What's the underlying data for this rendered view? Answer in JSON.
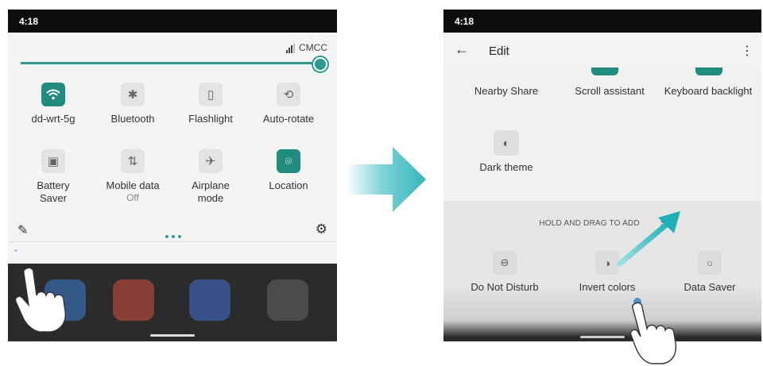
{
  "left_screen": {
    "status_time": "4:18",
    "carrier": "CMCC",
    "tiles": [
      {
        "label": "dd-wrt-5g",
        "sub": "",
        "icon": "wifi-icon",
        "active": true
      },
      {
        "label": "Bluetooth",
        "sub": "",
        "icon": "bluetooth-icon",
        "active": false
      },
      {
        "label": "Flashlight",
        "sub": "",
        "icon": "flashlight-icon",
        "active": false
      },
      {
        "label": "Auto-rotate",
        "sub": "",
        "icon": "auto-rotate-icon",
        "active": false
      },
      {
        "label": "Battery\nSaver",
        "sub": "",
        "icon": "battery-saver-icon",
        "active": false
      },
      {
        "label": "Mobile data",
        "sub": "Off",
        "icon": "mobile-data-icon",
        "active": false
      },
      {
        "label": "Airplane\nmode",
        "sub": "",
        "icon": "airplane-icon",
        "active": false
      },
      {
        "label": "Location",
        "sub": "",
        "icon": "location-icon",
        "active": true
      }
    ]
  },
  "right_screen": {
    "status_time": "4:18",
    "title": "Edit",
    "edit_tiles": [
      "Nearby Share",
      "Scroll assistant",
      "Keyboard backlight",
      "Dark theme"
    ],
    "hold_hint": "HOLD AND DRAG TO ADD",
    "hold_tail": "S",
    "hold_tiles": [
      "Do Not Disturb",
      "Invert colors",
      "Data Saver"
    ]
  },
  "colors": {
    "accent": "#1f8c7d",
    "arrow": "#3bb9c0"
  }
}
